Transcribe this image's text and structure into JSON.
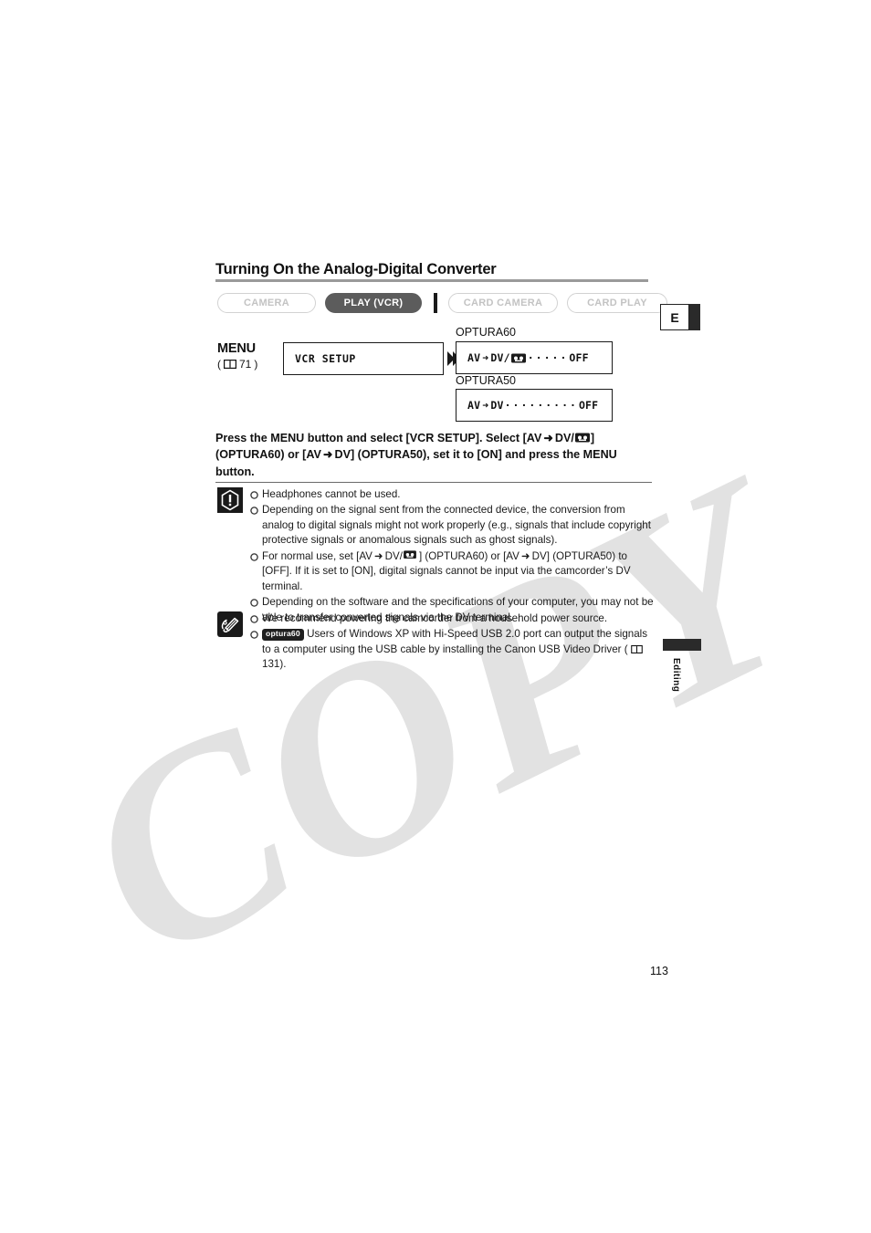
{
  "watermark": {
    "text": "COPY"
  },
  "title": "Turning On the Analog-Digital Converter",
  "mode_bar": {
    "modes": [
      {
        "label": "CAMERA",
        "state": "inactive"
      },
      {
        "label": "PLAY (VCR)",
        "state": "active"
      },
      {
        "label": "CARD CAMERA",
        "state": "inactive"
      },
      {
        "label": "CARD PLAY",
        "state": "inactive"
      }
    ]
  },
  "corner_tab": {
    "label": "E"
  },
  "menu_flow": {
    "menu_word": "MENU",
    "menu_ref_icon": "book-icon",
    "menu_ref_page": "71",
    "menu_ref_open": "(",
    "menu_ref_close": ")",
    "first_box": "VCR  SETUP",
    "arrow_icon": "flow-arrow-icon",
    "variant60": {
      "label": "OPTURA60",
      "setting_prefix": "AV",
      "setting_arrow": "➜",
      "setting_mid": "DV/",
      "setting_icon": "av-tape-icon",
      "setting_dots": "·····",
      "setting_value": "OFF"
    },
    "variant50": {
      "label": "OPTURA50",
      "setting_prefix": "AV",
      "setting_arrow": "➜",
      "setting_mid": "DV",
      "setting_dots": "·········",
      "setting_value": "OFF"
    }
  },
  "instruction": {
    "part1": "Press the MENU button and select [VCR SETUP]. Select [AV",
    "arrow": "➜",
    "part2": "DV/",
    "icon": "av-tape-icon",
    "part3": "]",
    "part4": "(OPTURA60) or [AV",
    "arrow2": "➜",
    "part5": "DV] (OPTURA50), set it to [ON] and press the MENU button."
  },
  "warning": {
    "icon": "warning-exclamation-icon",
    "items": [
      {
        "text": "Headphones cannot be used."
      },
      {
        "text": "Depending on the signal sent from the connected device, the conversion from analog to digital signals might not work properly (e.g., signals that include copyright protective signals or anomalous signals such as ghost signals)."
      },
      {
        "pre": "For normal use, set [AV",
        "arrow": "➜",
        "mid": "DV/",
        "icon": "av-tape-icon",
        "mid2": "] (OPTURA60) or [AV",
        "arrow2": "➜",
        "post": "DV] (OPTURA50) to [OFF]. If it is set to [ON], digital signals cannot be input via the camcorder’s DV terminal."
      },
      {
        "text": "Depending on the software and the specifications of your computer, you may not be able to transfer converted signals via the DV terminal."
      }
    ]
  },
  "tip": {
    "icon": "notes-pencil-icon",
    "items": [
      {
        "text": "We recommend powering the camcorder from a household power source."
      },
      {
        "badge": "optura60",
        "pre": "Users of Windows XP with Hi-Speed USB 2.0 port can output the signals to a computer using the USB cable by installing the Canon USB Video Driver (",
        "ref_icon": "book-icon",
        "ref_page": "131",
        "post": ")."
      }
    ]
  },
  "side_tab": {
    "label": "Editing"
  },
  "page_number": "113",
  "colors": {
    "active_button_bg": "#5c5c5c",
    "inactive_button_border": "#d2d2d2",
    "inactive_button_text": "#c3c3c3",
    "rule": "#9a9a9a",
    "watermark": "#e2e2e2",
    "ink": "#1a1a1a"
  }
}
